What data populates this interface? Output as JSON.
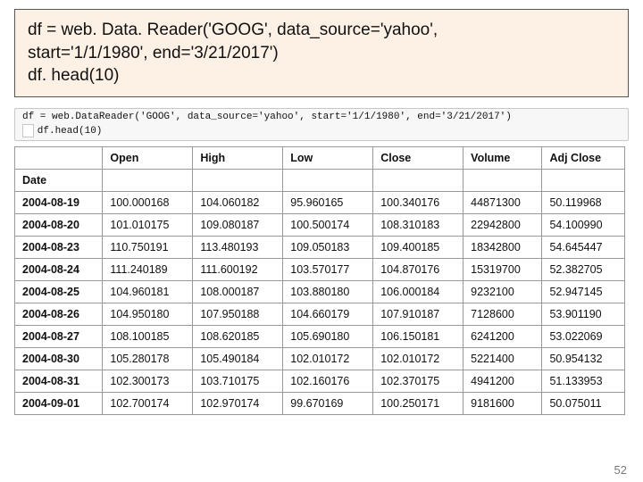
{
  "banner": {
    "line1": "df = web. Data. Reader('GOOG', data_source='yahoo',",
    "line2": "start='1/1/1980', end='3/21/2017')",
    "line3": "df. head(10)"
  },
  "codecell": {
    "in_prompt": "",
    "line1": "df = web.DataReader('GOOG', data_source='yahoo', start='1/1/1980', end='3/21/2017')",
    "line2": "df.head(10)"
  },
  "table": {
    "index_name": "Date",
    "columns": [
      "Open",
      "High",
      "Low",
      "Close",
      "Volume",
      "Adj Close"
    ],
    "rows": [
      {
        "idx": "2004-08-19",
        "cells": [
          "100.000168",
          "104.060182",
          "95.960165",
          "100.340176",
          "44871300",
          "50.119968"
        ]
      },
      {
        "idx": "2004-08-20",
        "cells": [
          "101.010175",
          "109.080187",
          "100.500174",
          "108.310183",
          "22942800",
          "54.100990"
        ]
      },
      {
        "idx": "2004-08-23",
        "cells": [
          "110.750191",
          "113.480193",
          "109.050183",
          "109.400185",
          "18342800",
          "54.645447"
        ]
      },
      {
        "idx": "2004-08-24",
        "cells": [
          "111.240189",
          "111.600192",
          "103.570177",
          "104.870176",
          "15319700",
          "52.382705"
        ]
      },
      {
        "idx": "2004-08-25",
        "cells": [
          "104.960181",
          "108.000187",
          "103.880180",
          "106.000184",
          "9232100",
          "52.947145"
        ]
      },
      {
        "idx": "2004-08-26",
        "cells": [
          "104.950180",
          "107.950188",
          "104.660179",
          "107.910187",
          "7128600",
          "53.901190"
        ]
      },
      {
        "idx": "2004-08-27",
        "cells": [
          "108.100185",
          "108.620185",
          "105.690180",
          "106.150181",
          "6241200",
          "53.022069"
        ]
      },
      {
        "idx": "2004-08-30",
        "cells": [
          "105.280178",
          "105.490184",
          "102.010172",
          "102.010172",
          "5221400",
          "50.954132"
        ]
      },
      {
        "idx": "2004-08-31",
        "cells": [
          "102.300173",
          "103.710175",
          "102.160176",
          "102.370175",
          "4941200",
          "51.133953"
        ]
      },
      {
        "idx": "2004-09-01",
        "cells": [
          "102.700174",
          "102.970174",
          "99.670169",
          "100.250171",
          "9181600",
          "50.075011"
        ]
      }
    ]
  },
  "page_number": "52"
}
